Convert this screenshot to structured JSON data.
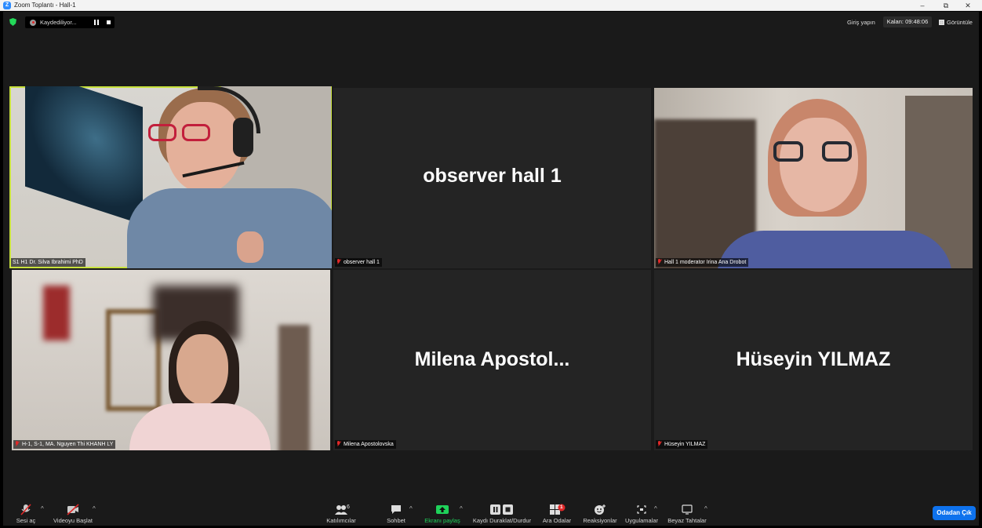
{
  "window": {
    "title": "Zoom Toplantı - Hall-1",
    "minimize": "–",
    "restore": "⧉",
    "close": "✕"
  },
  "top": {
    "recording": "Kaydediliyor...",
    "signin": "Giriş yapın",
    "timer": "Kalan: 09:48:06",
    "view": "Görüntüle"
  },
  "tiles": [
    {
      "label": "S1 H1 Dr. Silva Ibrahimi PhD",
      "muted": false,
      "video": true,
      "active": true
    },
    {
      "bigname": "observer hall 1",
      "label": "observer hall 1",
      "muted": true,
      "video": false
    },
    {
      "label": "Hall 1 moderator Irina Ana Drobot",
      "muted": true,
      "video": true
    },
    {
      "label": "H-1, S-1, MA. Nguyen Thi KHANH LY",
      "muted": true,
      "video": true
    },
    {
      "bigname": "Milena  Apostol...",
      "label": "Milena Apostolovska",
      "muted": true,
      "video": false
    },
    {
      "bigname": "Hüseyin YILMAZ",
      "label": "Hüseyin YILMAZ",
      "muted": true,
      "video": false
    }
  ],
  "toolbar": {
    "audio": "Sesi aç",
    "video": "Videoyu Başlat",
    "participants": "Katılımcılar",
    "participants_count": "6",
    "chat": "Sohbet",
    "share": "Ekranı paylaş",
    "record": "Kaydı Duraklat/Durdur",
    "breakout": "Ara Odalar",
    "breakout_badge": "1",
    "reactions": "Reaksiyonlar",
    "apps": "Uygulamalar",
    "whiteboard": "Beyaz Tahtalar",
    "leave": "Odadan Çık",
    "caret": "^"
  },
  "colors": {
    "active_speaker": "#c8e23c",
    "share_green": "#1fd25a",
    "leave_blue": "#0e72ed",
    "muted_red": "#e02828"
  }
}
